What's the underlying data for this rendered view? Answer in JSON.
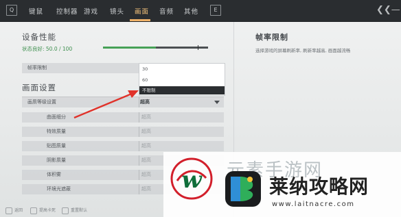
{
  "nav": {
    "left_key": "Q",
    "right_key": "E",
    "tabs": [
      {
        "label": "键鼠"
      },
      {
        "label": "控制器"
      },
      {
        "label": "游戏"
      },
      {
        "label": "镜头"
      },
      {
        "label": "画面"
      },
      {
        "label": "音频"
      },
      {
        "label": "其他"
      }
    ],
    "active_tab": "画面"
  },
  "device": {
    "title": "设备性能",
    "status": "状态良好: 50.0 / 100",
    "score": 50.0,
    "max": 100
  },
  "frame_limit_row": {
    "label": "帧率限制",
    "options": [
      "30",
      "60",
      "不限制"
    ],
    "selected": "不限制"
  },
  "display": {
    "title": "画面设置",
    "rows": [
      {
        "label": "画质等级设置",
        "value": "超高",
        "main": true
      },
      {
        "label": "曲面细分",
        "value": "超高"
      },
      {
        "label": "特效质量",
        "value": "超高"
      },
      {
        "label": "贴图质量",
        "value": "超高"
      },
      {
        "label": "阴影质量",
        "value": "超高"
      },
      {
        "label": "体积雾",
        "value": "超高"
      },
      {
        "label": "环境光遮蔽",
        "value": "超高"
      }
    ]
  },
  "detail": {
    "title": "帧率限制",
    "description": "选择游戏的屏幕刷新率, 刷新率越高, 画面越流畅"
  },
  "hints": [
    {
      "label": "返回"
    },
    {
      "label": "提高卡死"
    },
    {
      "label": "重置默认"
    }
  ],
  "watermark": {
    "name": "莱纳攻略网",
    "url": "www.laitnacre.com",
    "faint": "元素手游网"
  },
  "colors": {
    "accent": "#f0b36a",
    "status_green": "#3e8f4e",
    "arrow_red": "#e0322a",
    "topbar": "#2a2d30"
  }
}
